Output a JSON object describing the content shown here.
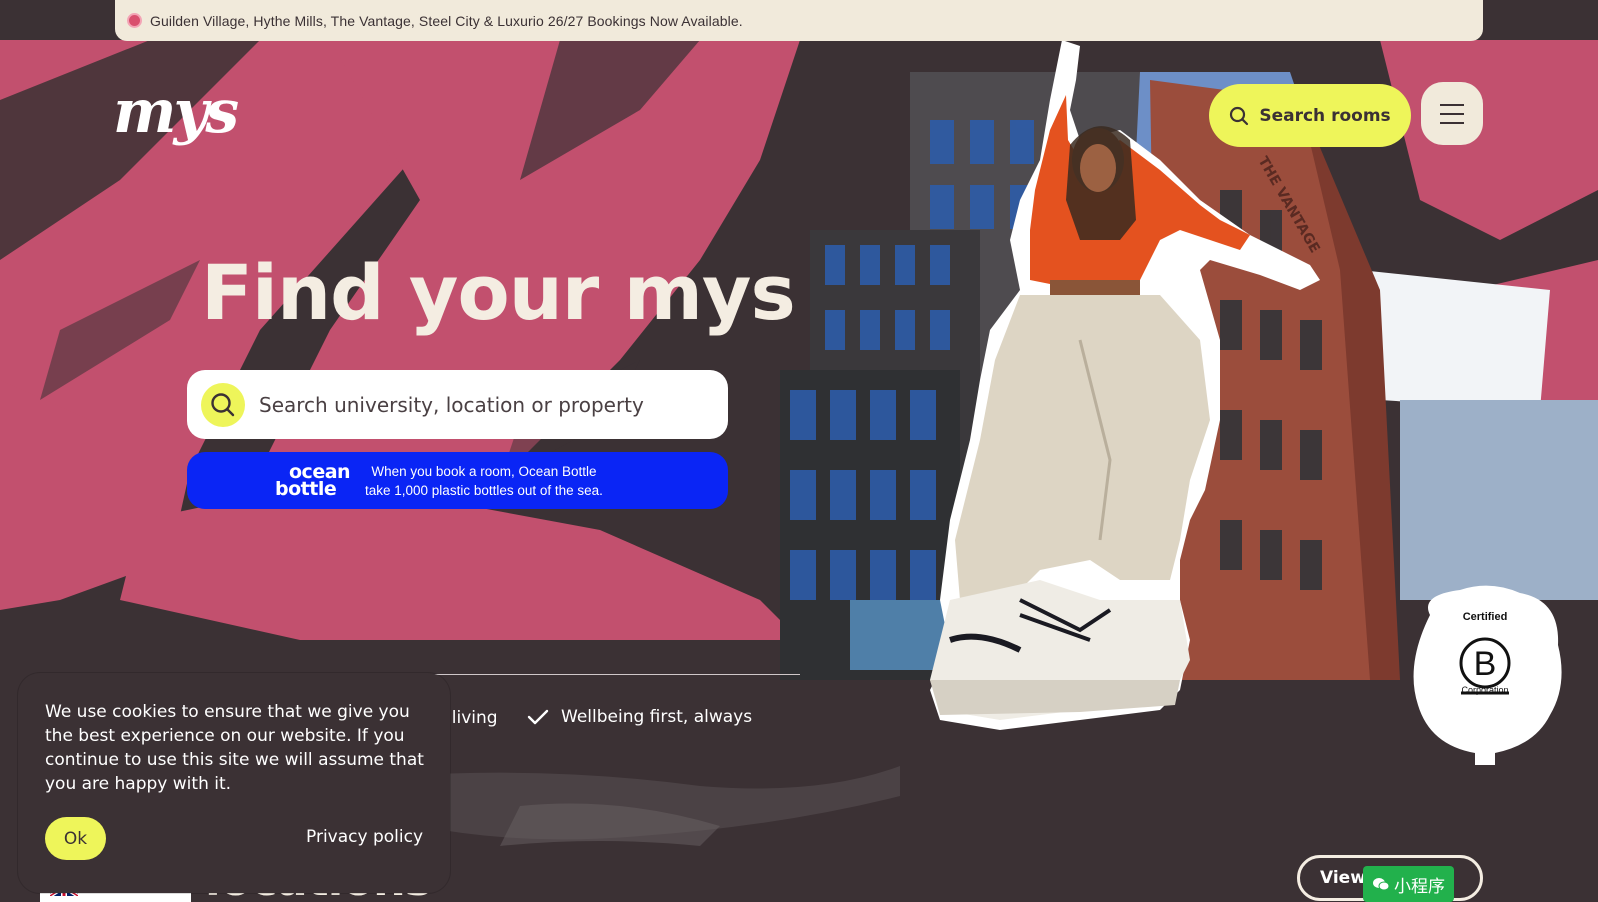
{
  "announcement": {
    "text": "Guilden Village, Hythe Mills, The Vantage, Steel City & Luxurio 26/27 Bookings Now Available."
  },
  "header": {
    "logo_text": "mys",
    "search_rooms_label": "Search rooms"
  },
  "hero": {
    "title": "Find your mys",
    "search_placeholder": "Search university, location or property",
    "ocean_bottle": {
      "logo_line1": "ocean",
      "logo_line2": "bottle",
      "line1": "When you book a room, Ocean Bottle",
      "line2": "take 1,000 plastic bottles out of the sea."
    },
    "features": [
      "o living",
      "Wellbeing first, always"
    ],
    "building_sign": "THE VANTAGE"
  },
  "bcorp": {
    "top": "Certified",
    "letter": "B",
    "bottom": "Corporation"
  },
  "lower": {
    "heading": "locations",
    "view_button_label": "View s",
    "mini_program_label": "小程序",
    "language": "English"
  },
  "cookie": {
    "message": "We use cookies to ensure that we give you the best experience on our website. If you continue to use this site we will assume that you are happy with it.",
    "ok_label": "Ok",
    "privacy_label": "Privacy policy"
  },
  "colors": {
    "background": "#3b3134",
    "pink": "#c2506e",
    "yellow": "#eef55a",
    "cream": "#f1eadb",
    "ocean_blue": "#0a25f5",
    "wechat_green": "#22b14c"
  }
}
